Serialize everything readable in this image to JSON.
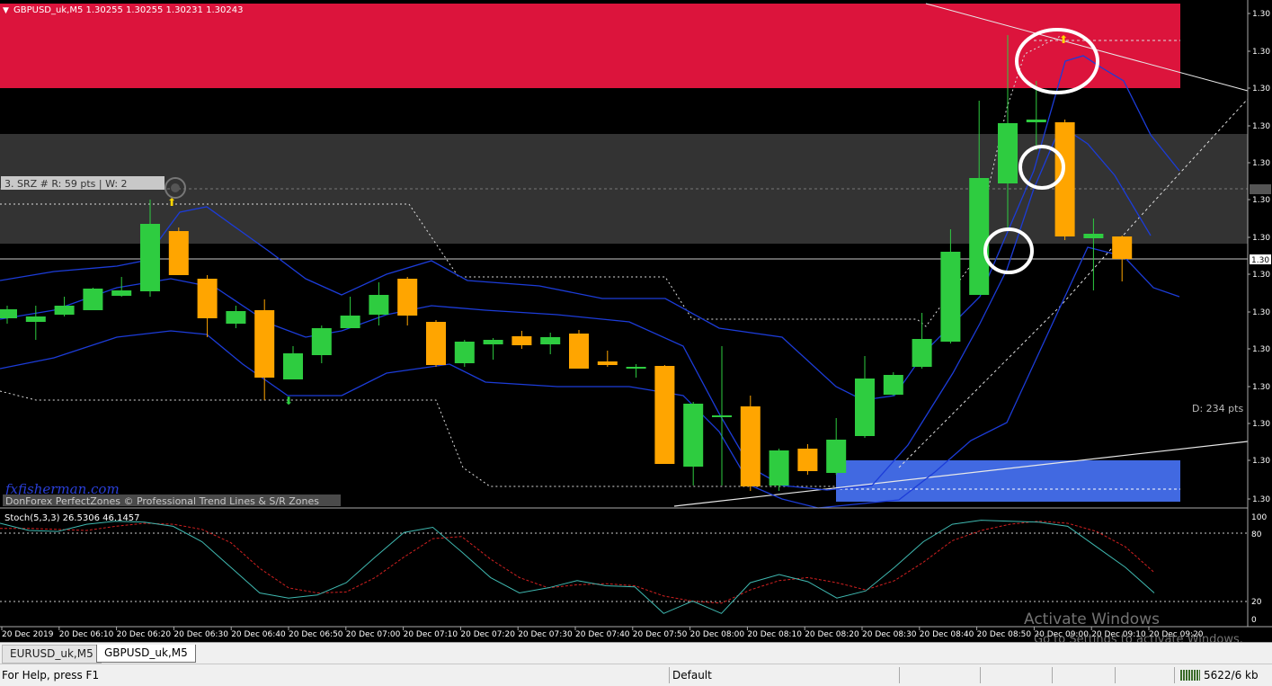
{
  "main_chart": {
    "header": "GBPUSD_uk,M5  1.30255 1.30255 1.30231 1.30243",
    "price_labels": [
      "1.30",
      "1.30",
      "1.30",
      "1.30",
      "1.30",
      "1.30",
      "1.30",
      "1.30",
      "1.30",
      "1.30",
      "1.30",
      "1.30",
      "1.30",
      "1.30"
    ],
    "current_price_tag": "1.30",
    "srz_label": "3. SRZ # R: 59 pts | W: 2",
    "distance_label": "D: 234 pts",
    "watermark": "fxfisherman.com",
    "footer_note": "DonForex PerfectZones © Professional Trend Lines & S/R Zones",
    "windows_activation": {
      "title": "Activate Windows",
      "subtitle": "Go to Settings to activate Windows."
    }
  },
  "sub_chart": {
    "header": "Stoch(5,3,3) 26.5306 46.1457",
    "scale_labels": [
      "100",
      "80",
      "20",
      "0"
    ]
  },
  "time_labels": [
    "20 Dec 2019",
    "20 Dec 06:10",
    "20 Dec 06:20",
    "20 Dec 06:30",
    "20 Dec 06:40",
    "20 Dec 06:50",
    "20 Dec 07:00",
    "20 Dec 07:10",
    "20 Dec 07:20",
    "20 Dec 07:30",
    "20 Dec 07:40",
    "20 Dec 07:50",
    "20 Dec 08:00",
    "20 Dec 08:10",
    "20 Dec 08:20",
    "20 Dec 08:30",
    "20 Dec 08:40",
    "20 Dec 08:50",
    "20 Dec 09:00",
    "20 Dec 09:10",
    "20 Dec 09:20"
  ],
  "tabs": [
    {
      "label": "EURUSD_uk,M5",
      "active": false
    },
    {
      "label": "GBPUSD_uk,M5",
      "active": true
    }
  ],
  "status": {
    "help": "For Help, press F1",
    "profile": "Default",
    "traffic": "5622/6 kb"
  },
  "colors": {
    "bull": "#2ecc40",
    "bear": "#ffa500",
    "resistance_zone": "#dc143c",
    "support_zone": "#4169e1",
    "grey_zone": "#333333",
    "bollinger": "#1c3cd8",
    "stoch_main": "#3fb8b0",
    "stoch_signal": "#d02020"
  },
  "chart_data": {
    "type": "candlestick",
    "symbol": "GBPUSD_uk",
    "timeframe": "M5",
    "ohlc_last": {
      "open": 1.30255,
      "high": 1.30255,
      "low": 1.30231,
      "close": 1.30243
    },
    "candles": [
      {
        "dir": "bull",
        "o": 344,
        "c": 354,
        "h": 340,
        "l": 360
      },
      {
        "dir": "bull",
        "o": 352,
        "c": 358,
        "h": 340,
        "l": 378
      },
      {
        "dir": "bull",
        "o": 340,
        "c": 350,
        "h": 330,
        "l": 352
      },
      {
        "dir": "bull",
        "o": 321,
        "c": 345,
        "h": 320,
        "l": 345
      },
      {
        "dir": "bull",
        "o": 323,
        "c": 329,
        "h": 308,
        "l": 330
      },
      {
        "dir": "bull",
        "o": 249,
        "c": 324,
        "h": 222,
        "l": 330
      },
      {
        "dir": "bear",
        "o": 257,
        "c": 306,
        "h": 253,
        "l": 306
      },
      {
        "dir": "bear",
        "o": 310,
        "c": 354,
        "h": 306,
        "l": 375
      },
      {
        "dir": "bull",
        "o": 346,
        "c": 360,
        "h": 340,
        "l": 365
      },
      {
        "dir": "bear",
        "o": 345,
        "c": 420,
        "h": 333,
        "l": 445
      },
      {
        "dir": "bull",
        "o": 393,
        "c": 422,
        "h": 385,
        "l": 422
      },
      {
        "dir": "bull",
        "o": 365,
        "c": 395,
        "h": 362,
        "l": 404
      },
      {
        "dir": "bull",
        "o": 351,
        "c": 365,
        "h": 330,
        "l": 365
      },
      {
        "dir": "bull",
        "o": 328,
        "c": 350,
        "h": 314,
        "l": 362
      },
      {
        "dir": "bear",
        "o": 310,
        "c": 351,
        "h": 308,
        "l": 362
      },
      {
        "dir": "bear",
        "o": 358,
        "c": 406,
        "h": 356,
        "l": 408
      },
      {
        "dir": "bull",
        "o": 380,
        "c": 404,
        "h": 378,
        "l": 408
      },
      {
        "dir": "bull",
        "o": 378,
        "c": 383,
        "h": 376,
        "l": 400
      },
      {
        "dir": "bear",
        "o": 374,
        "c": 384,
        "h": 368,
        "l": 388
      },
      {
        "dir": "bull",
        "o": 375,
        "c": 383,
        "h": 370,
        "l": 394
      },
      {
        "dir": "bear",
        "o": 371,
        "c": 410,
        "h": 367,
        "l": 410
      },
      {
        "dir": "bear",
        "o": 402,
        "c": 406,
        "h": 390,
        "l": 408
      },
      {
        "dir": "doji",
        "o": 408,
        "c": 410,
        "h": 405,
        "l": 420
      },
      {
        "dir": "bear",
        "o": 407,
        "c": 516,
        "h": 406,
        "l": 516
      },
      {
        "dir": "bull",
        "o": 449,
        "c": 519,
        "h": 447,
        "l": 540
      },
      {
        "dir": "doji",
        "o": 462,
        "c": 464,
        "h": 385,
        "l": 540
      },
      {
        "dir": "bear",
        "o": 452,
        "c": 541,
        "h": 440,
        "l": 546
      },
      {
        "dir": "bull",
        "o": 501,
        "c": 540,
        "h": 499,
        "l": 546
      },
      {
        "dir": "bear",
        "o": 499,
        "c": 524,
        "h": 494,
        "l": 528
      },
      {
        "dir": "bull",
        "o": 489,
        "c": 526,
        "h": 465,
        "l": 528
      },
      {
        "dir": "bull",
        "o": 421,
        "c": 485,
        "h": 396,
        "l": 487
      },
      {
        "dir": "bull",
        "o": 417,
        "c": 439,
        "h": 414,
        "l": 440
      },
      {
        "dir": "bull",
        "o": 377,
        "c": 408,
        "h": 348,
        "l": 410
      },
      {
        "dir": "bull",
        "o": 280,
        "c": 380,
        "h": 255,
        "l": 382
      },
      {
        "dir": "bull",
        "o": 198,
        "c": 328,
        "h": 112,
        "l": 328
      },
      {
        "dir": "bull",
        "o": 137,
        "c": 204,
        "h": 39,
        "l": 253
      },
      {
        "dir": "bull",
        "o": 133,
        "c": 136,
        "h": 90,
        "l": 167
      },
      {
        "dir": "bear",
        "o": 136,
        "c": 263,
        "h": 133,
        "l": 267
      },
      {
        "dir": "bull",
        "o": 260,
        "c": 265,
        "h": 243,
        "l": 323
      },
      {
        "dir": "bear",
        "o": 263,
        "c": 288,
        "h": 262,
        "l": 313
      }
    ],
    "stochastic": {
      "name": "Stoch(5,3,3)",
      "main_last": 26.5306,
      "signal_last": 46.1457,
      "levels": [
        80,
        20
      ],
      "range": [
        0,
        100
      ],
      "main": [
        93,
        86,
        85,
        92,
        95,
        94,
        90,
        75,
        50,
        25,
        20,
        23,
        35,
        60,
        84,
        89,
        65,
        40,
        25,
        30,
        37,
        32,
        31,
        5,
        17,
        5,
        35,
        43,
        36,
        20,
        27,
        50,
        75,
        92,
        96,
        95,
        94,
        90,
        70,
        50,
        25
      ],
      "signal": [
        88,
        88,
        87,
        86,
        90,
        93,
        92,
        87,
        74,
        49,
        30,
        25,
        26,
        40,
        60,
        78,
        80,
        58,
        40,
        30,
        33,
        34,
        32,
        22,
        17,
        15,
        28,
        37,
        40,
        35,
        28,
        37,
        55,
        76,
        86,
        92,
        95,
        93,
        85,
        70,
        45
      ]
    }
  }
}
